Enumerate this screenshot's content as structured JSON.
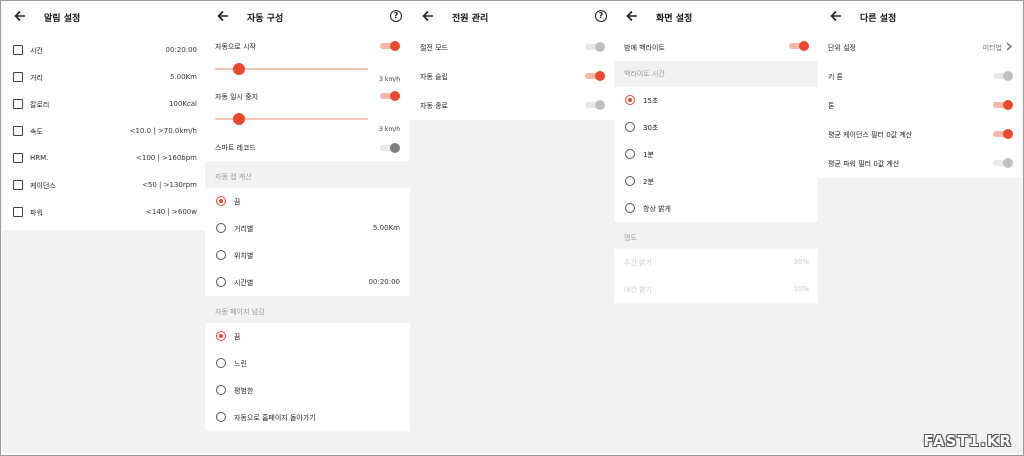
{
  "panels": {
    "alert": {
      "title": "알림 설정",
      "items": [
        {
          "label": "시간",
          "value": "00:20:00"
        },
        {
          "label": "거리",
          "value": "5.00Km"
        },
        {
          "label": "칼로리",
          "value": "100Kcal"
        },
        {
          "label": "속도",
          "value": "<10.0 | >70.0km/h"
        },
        {
          "label": "HRM.",
          "value": "<100 | >160bpm"
        },
        {
          "label": "케이던스",
          "value": "<50 | >130rpm"
        },
        {
          "label": "파워",
          "value": "<140 | >600w"
        }
      ]
    },
    "auto": {
      "title": "자동 구성",
      "help": "?",
      "auto_start": {
        "label": "자동으로 시작",
        "on": true,
        "speed": "3 km/h"
      },
      "auto_pause": {
        "label": "자동 일시 중지",
        "on": true,
        "speed": "3 km/h"
      },
      "smart_record": {
        "label": "스마트 레코드",
        "on": false
      },
      "lap_section": "자동 랩 계산",
      "lap_options": [
        {
          "label": "끔",
          "value": "",
          "selected": true
        },
        {
          "label": "거리별",
          "value": "5.00Km",
          "selected": false
        },
        {
          "label": "위치별",
          "value": "",
          "selected": false
        },
        {
          "label": "시간별",
          "value": "00:20:00",
          "selected": false
        }
      ],
      "page_section": "자동 페이지 넘김",
      "page_options": [
        {
          "label": "끔",
          "selected": true
        },
        {
          "label": "느린",
          "selected": false
        },
        {
          "label": "평범한",
          "selected": false
        },
        {
          "label": "자동으로 홈페이지 돌아가기",
          "selected": false
        }
      ]
    },
    "power": {
      "title": "전원 관리",
      "help": "?",
      "items": [
        {
          "label": "절전 모드",
          "on": false
        },
        {
          "label": "자동 슬립",
          "on": true
        },
        {
          "label": "자동 종료",
          "on": false
        }
      ]
    },
    "screen": {
      "title": "화면 설정",
      "night_backlight": {
        "label": "밤에 백라이트",
        "on": true
      },
      "backlight_section": "백라이트 시간",
      "backlight_options": [
        {
          "label": "15초",
          "selected": true
        },
        {
          "label": "30초",
          "selected": false
        },
        {
          "label": "1분",
          "selected": false
        },
        {
          "label": "2분",
          "selected": false
        },
        {
          "label": "항상 밝게",
          "selected": false
        }
      ],
      "brightness_section": "명도",
      "day_brightness": {
        "label": "주간 밝기",
        "value": "30%"
      },
      "night_brightness": {
        "label": "야간 밝기",
        "value": "10%"
      }
    },
    "other": {
      "title": "다른 설정",
      "unit": {
        "label": "단위 설정",
        "value": "미터법"
      },
      "items": [
        {
          "label": "키 톤",
          "on": false
        },
        {
          "label": "톤",
          "on": true
        },
        {
          "label": "평균 케이던스 필터 0값 계산",
          "on": true
        },
        {
          "label": "평균 파워 필터 0값 계산",
          "on": false
        }
      ]
    }
  },
  "watermark": "FAST1.KR",
  "colors": {
    "accent": "#e84a2f",
    "background": "#f2f2f2"
  }
}
